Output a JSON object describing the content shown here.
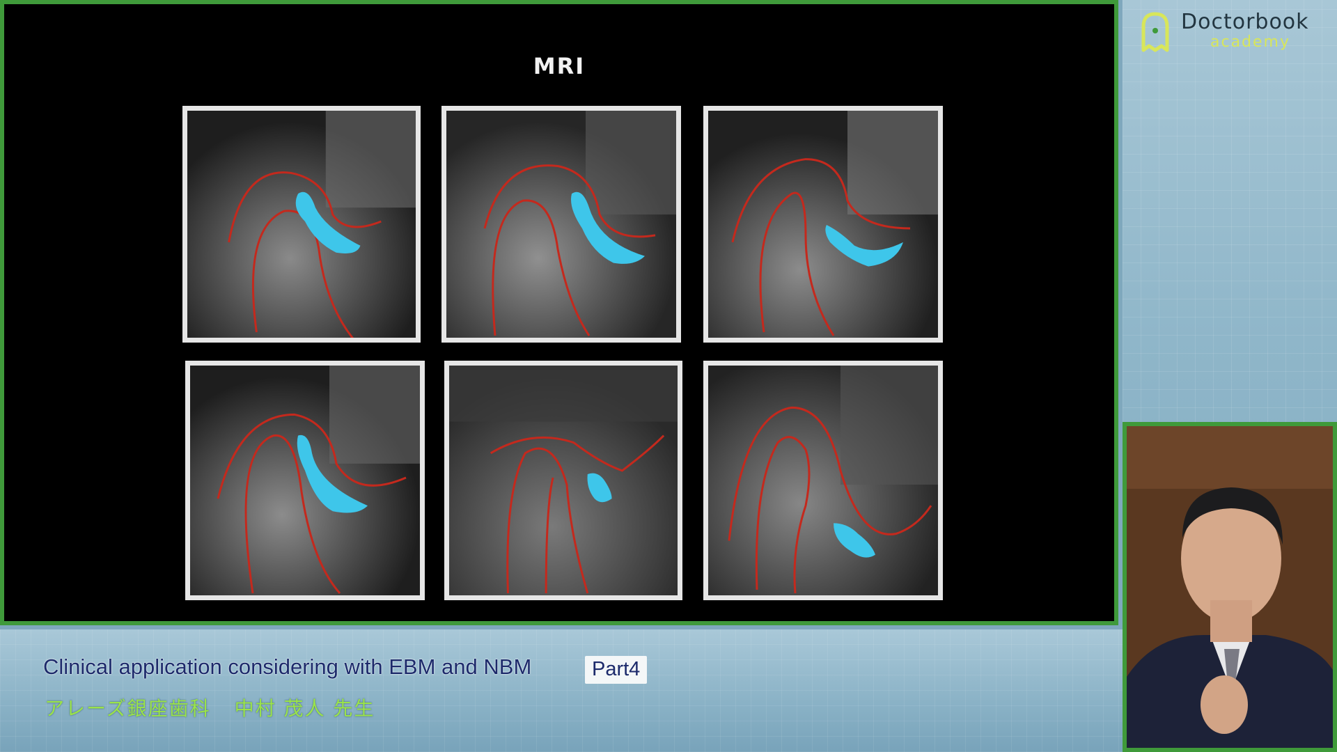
{
  "slide": {
    "title": "MRI"
  },
  "mri_images": [
    {
      "label": "mri-top-left"
    },
    {
      "label": "mri-top-middle"
    },
    {
      "label": "mri-top-right"
    },
    {
      "label": "mri-bottom-left"
    },
    {
      "label": "mri-bottom-middle"
    },
    {
      "label": "mri-bottom-right"
    }
  ],
  "annotation_colors": {
    "bone_outline": "#c4291d",
    "disc": "#3ec6ea"
  },
  "logo": {
    "name": "Doctorbook",
    "sub": "academy",
    "accent": "#d8e65a"
  },
  "caption": {
    "title": "Clinical application considering with EBM and NBM",
    "part": "Part4",
    "clinic": "アレーズ銀座歯科",
    "presenter": "中村 茂人 先生"
  },
  "frame_color": "#3f9a3a"
}
